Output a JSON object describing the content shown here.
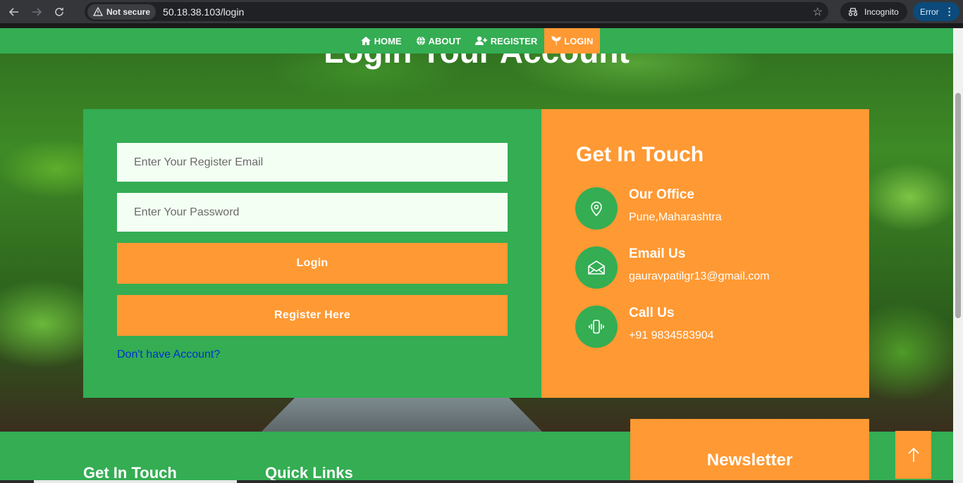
{
  "browser": {
    "security_label": "Not secure",
    "url": "50.18.38.103/login",
    "incognito_label": "Incognito",
    "error_label": "Error"
  },
  "nav": {
    "items": [
      {
        "label": "HOME",
        "icon": "home-icon"
      },
      {
        "label": "ABOUT",
        "icon": "globe-icon"
      },
      {
        "label": "REGISTER",
        "icon": "user-plus-icon"
      },
      {
        "label": "LOGIN",
        "icon": "seedling-icon",
        "active": true
      }
    ]
  },
  "hero": {
    "title": "Login Your Account"
  },
  "login_form": {
    "email_placeholder": "Enter Your Register Email",
    "password_placeholder": "Enter Your Password",
    "login_label": "Login",
    "register_label": "Register Here",
    "account_link": "Don't have Account?"
  },
  "contact": {
    "title": "Get In Touch",
    "office": {
      "heading": "Our Office",
      "value": "Pune,Maharashtra"
    },
    "email": {
      "heading": "Email Us",
      "value": "gauravpatilgr13@gmail.com"
    },
    "call": {
      "heading": "Call Us",
      "value": "+91 9834583904"
    }
  },
  "footer": {
    "get_in_touch": "Get In Touch",
    "quick_links": "Quick Links",
    "newsletter": "Newsletter"
  },
  "colors": {
    "green": "#34ad53",
    "orange": "#ff9933",
    "link": "#0033cc"
  }
}
